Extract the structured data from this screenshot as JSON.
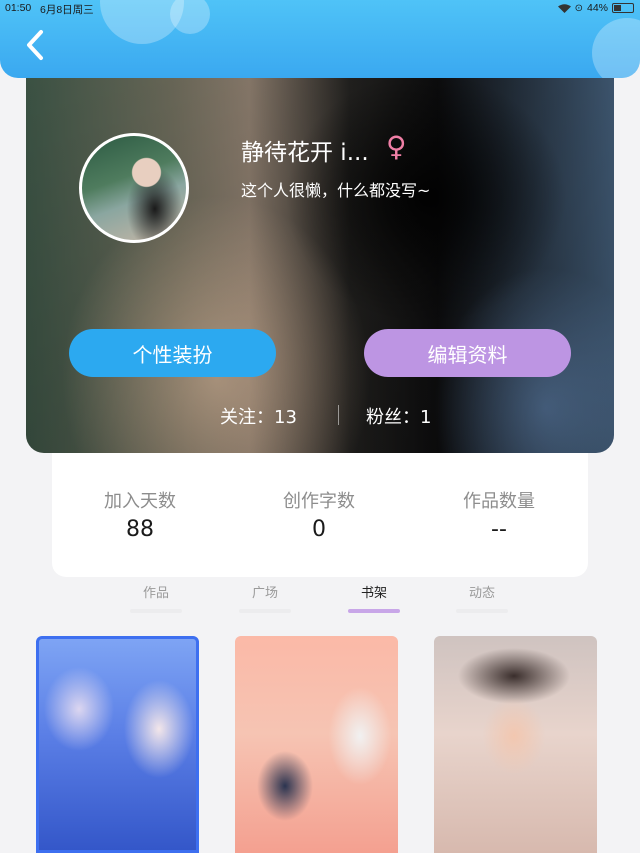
{
  "status_bar": {
    "time": "01:50",
    "date": "6月8日周三",
    "battery": "44%",
    "battery_fraction": 0.44
  },
  "header": {
    "back_icon": "chevron-left-icon"
  },
  "profile": {
    "name": "静待花开 i...",
    "gender_symbol": "♀",
    "bio": "这个人很懒，什么都没写~",
    "dress_button": "个性装扮",
    "edit_button": "编辑资料",
    "follow_label": "关注：13",
    "fans_label": "粉丝：1"
  },
  "stats": [
    {
      "label": "加入天数",
      "value": "88"
    },
    {
      "label": "创作字数",
      "value": "0"
    },
    {
      "label": "作品数量",
      "value": "--"
    }
  ],
  "tabs": [
    {
      "label": "作品",
      "active": false
    },
    {
      "label": "广场",
      "active": false
    },
    {
      "label": "书架",
      "active": true
    },
    {
      "label": "动态",
      "active": false
    }
  ],
  "colors": {
    "header": "#3aa8f0",
    "dress_button": "#2ca9f0",
    "edit_button": "#bd95e3",
    "gender": "#f07fa6",
    "tab_indicator": "#c8a6e8"
  }
}
